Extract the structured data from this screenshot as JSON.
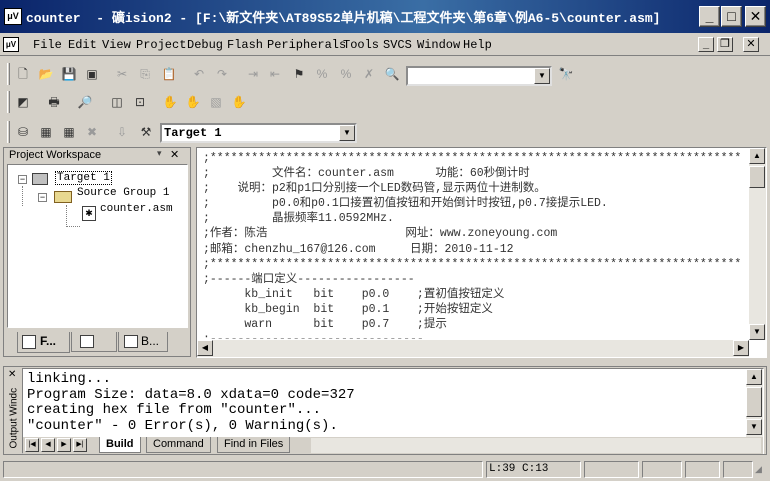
{
  "window": {
    "title": "counter  - 礦ision2 - [F:\\新文件夹\\AT89S52单片机稿\\工程文件夹\\第6章\\例A6-5\\counter.asm]",
    "app_icon": "μV"
  },
  "menu": [
    "File",
    "Edit",
    "View",
    "Project",
    "Debug",
    "Flash",
    "Peripherals",
    "Tools",
    "SVCS",
    "Window",
    "Help"
  ],
  "toolbar": {
    "find_combo_value": "",
    "target_combo_value": "Target 1"
  },
  "project_workspace": {
    "title": "Project Workspace",
    "tree": {
      "target": "Target 1",
      "group": "Source Group 1",
      "file": "counter.asm"
    },
    "tabs": [
      "F...",
      "",
      "B..."
    ]
  },
  "editor": {
    "lines": [
      ";*****************************************************************************",
      ";         文件名：counter.asm      功能：60秒倒计时",
      ";    说明：p2和p1口分别接一个LED数码管,显示两位十进制数。",
      ";         p0.0和p0.1口接置初值按钮和开始倒计时按钮,p0.7接提示LED.",
      ";         晶振频率11.0592MHz.",
      ";作者：陈浩                    网址：www.zoneyoung.com",
      ";邮箱：chenzhu_167@126.com     日期：2010-11-12",
      ";*****************************************************************************",
      ";------端口定义-----------------",
      "      kb_init   bit    p0.0    ;置初值按钮定义",
      "      kb_begin  bit    p0.1    ;开始按钮定义",
      "      warn      bit    p0.7    ;提示",
      ";-------------------------------"
    ]
  },
  "output": {
    "side_label": "Output Windc",
    "lines": [
      "linking...",
      "Program Size: data=8.0 xdata=0 code=327",
      "creating hex file from \"counter\"...",
      "\"counter\" - 0 Error(s), 0 Warning(s)."
    ],
    "tabs": [
      "Build",
      "Command",
      "Find in Files"
    ]
  },
  "status": {
    "position": "L:39 C:13"
  }
}
